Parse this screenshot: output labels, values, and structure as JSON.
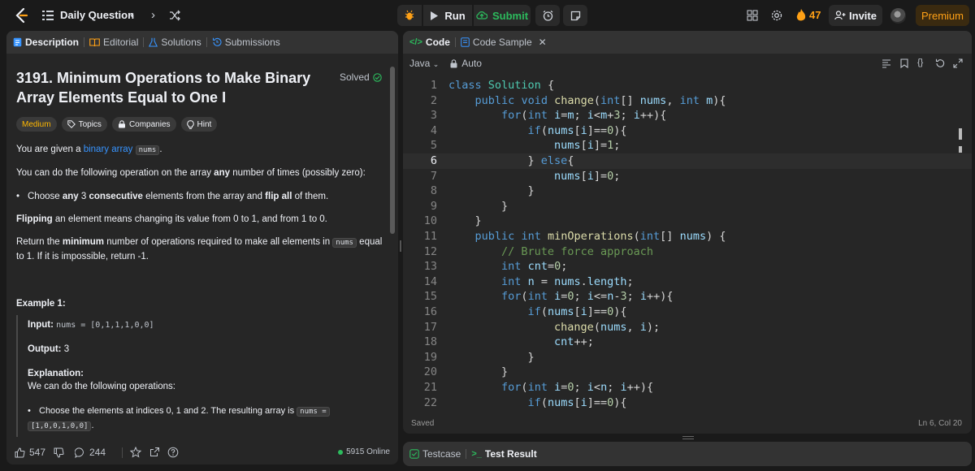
{
  "topbar": {
    "title": "Daily Question",
    "run_label": "Run",
    "submit_label": "Submit",
    "streak": "47",
    "invite_label": "Invite",
    "premium_label": "Premium"
  },
  "left_tabs": [
    "Description",
    "Editorial",
    "Solutions",
    "Submissions"
  ],
  "problem": {
    "title": "3191. Minimum Operations to Make Binary Array Elements Equal to One I",
    "status": "Solved",
    "chips": [
      "Medium",
      "Topics",
      "Companies",
      "Hint"
    ],
    "intro_pre": "You are given a ",
    "intro_link": "binary array",
    "intro_code": "nums",
    "intro_post": ".",
    "op_pre": "You can do the following operation on the array ",
    "op_bold": "any",
    "op_post": " number of times (possibly zero):",
    "bullet_a": "Choose ",
    "bullet_b": "any",
    "bullet_c": " 3 ",
    "bullet_d": "consecutive",
    "bullet_e": " elements from the array and ",
    "bullet_f": "flip all",
    "bullet_g": " of them.",
    "flip_bold": "Flipping",
    "flip_rest": " an element means changing its value from 0 to 1, and from 1 to 0.",
    "ret_pre": "Return the ",
    "ret_bold": "minimum",
    "ret_mid": " number of operations required to make all elements in ",
    "ret_code": "nums",
    "ret_post": " equal to 1. If it is impossible, return -1.",
    "example_title": "Example 1:",
    "input_label": "Input:",
    "input_value": "nums = [0,1,1,1,0,0]",
    "output_label": "Output:",
    "output_value": "3",
    "explanation_label": "Explanation:",
    "explanation_text": "We can do the following operations:",
    "ex_bullet": "Choose the elements at indices 0, 1 and 2. The resulting array is ",
    "ex_code_a": "nums =",
    "ex_code_b": "[1,0,0,1,0,0]",
    "ex_bullet_end": "."
  },
  "left_bottom": {
    "likes": "547",
    "comments": "244",
    "online": "5915 Online"
  },
  "code_tabs": [
    "Code",
    "Code Sample"
  ],
  "code_sub": {
    "language": "Java",
    "mode": "Auto"
  },
  "code_lines": [
    "class Solution {",
    "    public void change(int[] nums, int m){",
    "        for(int i=m; i<m+3; i++){",
    "            if(nums[i]==0){",
    "                nums[i]=1;",
    "            } else{",
    "                nums[i]=0;",
    "            }",
    "        }",
    "    }",
    "    public int minOperations(int[] nums) {",
    "        // Brute force approach",
    "        int cnt=0;",
    "        int n = nums.length;",
    "        for(int i=0; i<=n-3; i++){",
    "            if(nums[i]==0){",
    "                change(nums, i);",
    "                cnt++;",
    "            }",
    "        }",
    "        for(int i=0; i<n; i++){",
    "            if(nums[i]==0){"
  ],
  "editor_foot": {
    "saved": "Saved",
    "cursor": "Ln 6, Col 20"
  },
  "bottom_tabs": [
    "Testcase",
    "Test Result"
  ],
  "colors": {
    "accent": "#ffa116",
    "green": "#2cbb5d",
    "keyword": "#569cd6",
    "comment": "#6a9955",
    "link": "#3794ff"
  }
}
